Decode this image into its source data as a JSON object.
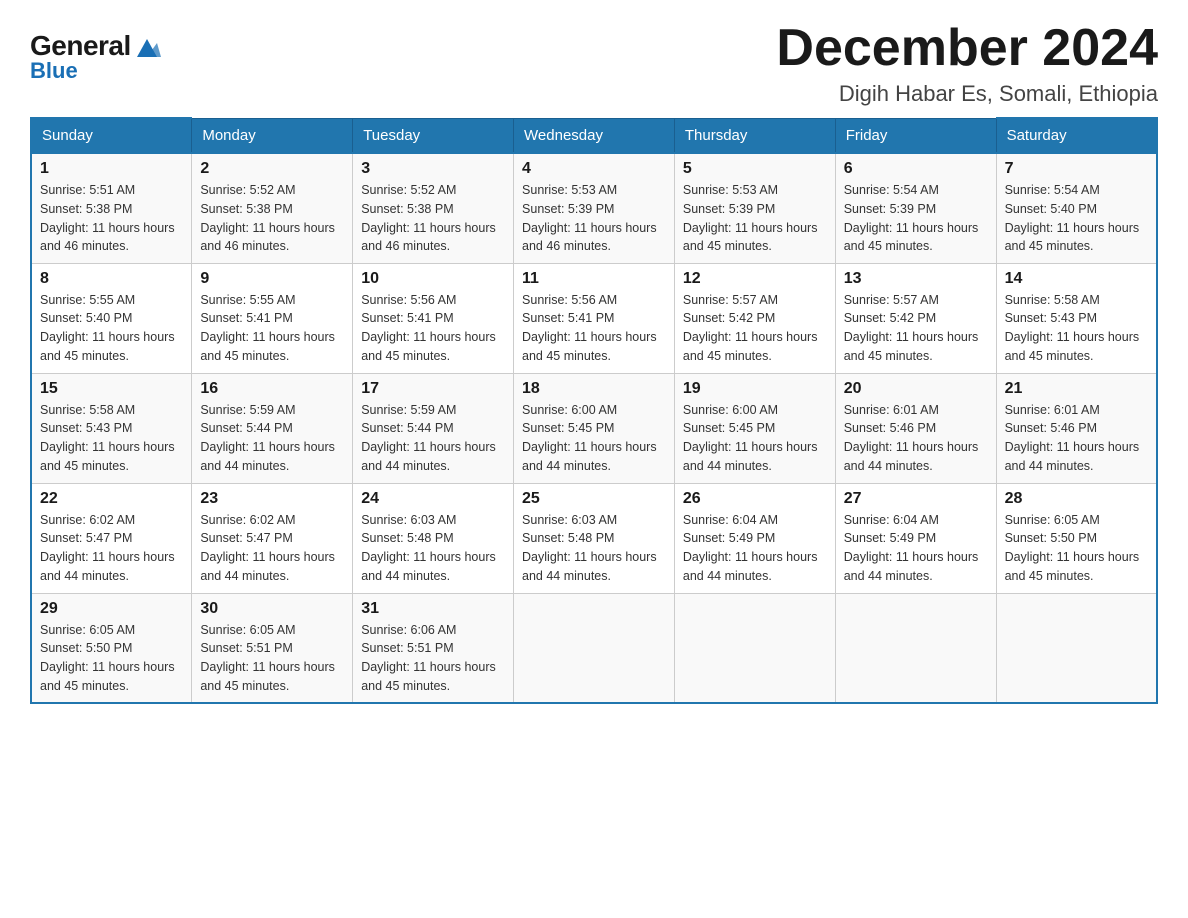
{
  "header": {
    "logo": {
      "general": "General",
      "blue": "Blue"
    },
    "title": "December 2024",
    "location": "Digih Habar Es, Somali, Ethiopia"
  },
  "calendar": {
    "days": [
      "Sunday",
      "Monday",
      "Tuesday",
      "Wednesday",
      "Thursday",
      "Friday",
      "Saturday"
    ],
    "weeks": [
      [
        {
          "day": "1",
          "sunrise": "5:51 AM",
          "sunset": "5:38 PM",
          "daylight": "11 hours and 46 minutes."
        },
        {
          "day": "2",
          "sunrise": "5:52 AM",
          "sunset": "5:38 PM",
          "daylight": "11 hours and 46 minutes."
        },
        {
          "day": "3",
          "sunrise": "5:52 AM",
          "sunset": "5:38 PM",
          "daylight": "11 hours and 46 minutes."
        },
        {
          "day": "4",
          "sunrise": "5:53 AM",
          "sunset": "5:39 PM",
          "daylight": "11 hours and 46 minutes."
        },
        {
          "day": "5",
          "sunrise": "5:53 AM",
          "sunset": "5:39 PM",
          "daylight": "11 hours and 45 minutes."
        },
        {
          "day": "6",
          "sunrise": "5:54 AM",
          "sunset": "5:39 PM",
          "daylight": "11 hours and 45 minutes."
        },
        {
          "day": "7",
          "sunrise": "5:54 AM",
          "sunset": "5:40 PM",
          "daylight": "11 hours and 45 minutes."
        }
      ],
      [
        {
          "day": "8",
          "sunrise": "5:55 AM",
          "sunset": "5:40 PM",
          "daylight": "11 hours and 45 minutes."
        },
        {
          "day": "9",
          "sunrise": "5:55 AM",
          "sunset": "5:41 PM",
          "daylight": "11 hours and 45 minutes."
        },
        {
          "day": "10",
          "sunrise": "5:56 AM",
          "sunset": "5:41 PM",
          "daylight": "11 hours and 45 minutes."
        },
        {
          "day": "11",
          "sunrise": "5:56 AM",
          "sunset": "5:41 PM",
          "daylight": "11 hours and 45 minutes."
        },
        {
          "day": "12",
          "sunrise": "5:57 AM",
          "sunset": "5:42 PM",
          "daylight": "11 hours and 45 minutes."
        },
        {
          "day": "13",
          "sunrise": "5:57 AM",
          "sunset": "5:42 PM",
          "daylight": "11 hours and 45 minutes."
        },
        {
          "day": "14",
          "sunrise": "5:58 AM",
          "sunset": "5:43 PM",
          "daylight": "11 hours and 45 minutes."
        }
      ],
      [
        {
          "day": "15",
          "sunrise": "5:58 AM",
          "sunset": "5:43 PM",
          "daylight": "11 hours and 45 minutes."
        },
        {
          "day": "16",
          "sunrise": "5:59 AM",
          "sunset": "5:44 PM",
          "daylight": "11 hours and 44 minutes."
        },
        {
          "day": "17",
          "sunrise": "5:59 AM",
          "sunset": "5:44 PM",
          "daylight": "11 hours and 44 minutes."
        },
        {
          "day": "18",
          "sunrise": "6:00 AM",
          "sunset": "5:45 PM",
          "daylight": "11 hours and 44 minutes."
        },
        {
          "day": "19",
          "sunrise": "6:00 AM",
          "sunset": "5:45 PM",
          "daylight": "11 hours and 44 minutes."
        },
        {
          "day": "20",
          "sunrise": "6:01 AM",
          "sunset": "5:46 PM",
          "daylight": "11 hours and 44 minutes."
        },
        {
          "day": "21",
          "sunrise": "6:01 AM",
          "sunset": "5:46 PM",
          "daylight": "11 hours and 44 minutes."
        }
      ],
      [
        {
          "day": "22",
          "sunrise": "6:02 AM",
          "sunset": "5:47 PM",
          "daylight": "11 hours and 44 minutes."
        },
        {
          "day": "23",
          "sunrise": "6:02 AM",
          "sunset": "5:47 PM",
          "daylight": "11 hours and 44 minutes."
        },
        {
          "day": "24",
          "sunrise": "6:03 AM",
          "sunset": "5:48 PM",
          "daylight": "11 hours and 44 minutes."
        },
        {
          "day": "25",
          "sunrise": "6:03 AM",
          "sunset": "5:48 PM",
          "daylight": "11 hours and 44 minutes."
        },
        {
          "day": "26",
          "sunrise": "6:04 AM",
          "sunset": "5:49 PM",
          "daylight": "11 hours and 44 minutes."
        },
        {
          "day": "27",
          "sunrise": "6:04 AM",
          "sunset": "5:49 PM",
          "daylight": "11 hours and 44 minutes."
        },
        {
          "day": "28",
          "sunrise": "6:05 AM",
          "sunset": "5:50 PM",
          "daylight": "11 hours and 45 minutes."
        }
      ],
      [
        {
          "day": "29",
          "sunrise": "6:05 AM",
          "sunset": "5:50 PM",
          "daylight": "11 hours and 45 minutes."
        },
        {
          "day": "30",
          "sunrise": "6:05 AM",
          "sunset": "5:51 PM",
          "daylight": "11 hours and 45 minutes."
        },
        {
          "day": "31",
          "sunrise": "6:06 AM",
          "sunset": "5:51 PM",
          "daylight": "11 hours and 45 minutes."
        },
        null,
        null,
        null,
        null
      ]
    ]
  }
}
